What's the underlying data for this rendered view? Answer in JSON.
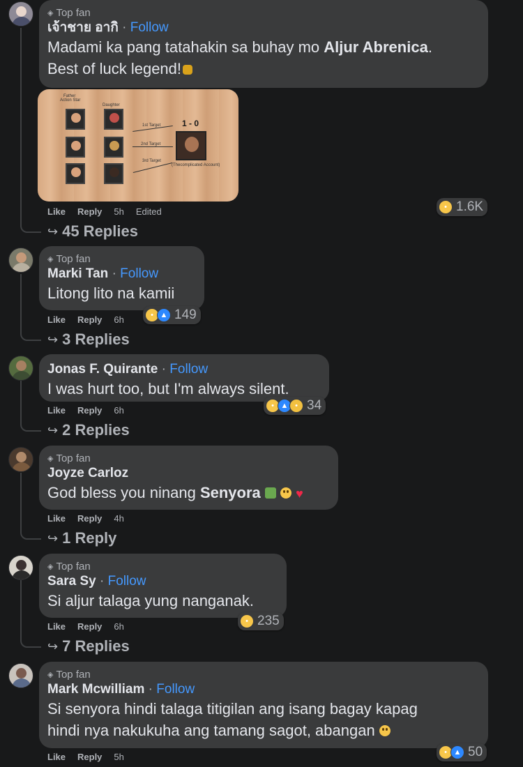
{
  "colors": {
    "background": "#18191a",
    "bubble": "#3a3b3c",
    "follow": "#4599ff",
    "muted": "#b0b3b8",
    "text": "#e4e6eb"
  },
  "comments": [
    {
      "badge": "Top fan",
      "author": "เจ้าชาย อากิ",
      "dot": "·",
      "follow": "Follow",
      "text_line1_pre": "Madami ka pang tatahakin sa buhay mo ",
      "text_line1_bold": "Aljur Abrenica",
      "text_line1_post": ".",
      "text_line2": "Best of luck legend!",
      "emoji_icon": "flexed-arm-icon",
      "media": {
        "labels": {
          "left_top": "Father",
          "left_sub": "Action Star",
          "mid_top": "Daughter",
          "target1": "1st Target",
          "target2": "2nd Target",
          "target3": "3rd Target",
          "score": "1 - 0",
          "caption": "(Thecomplicated Account)"
        }
      },
      "actions": {
        "like": "Like",
        "reply": "Reply",
        "time": "5h",
        "edited": "Edited"
      },
      "reactions": {
        "icons": [
          "haha"
        ],
        "count": "1.6K"
      },
      "replies": "45 Replies"
    },
    {
      "badge": "Top fan",
      "author": "Marki Tan",
      "dot": "·",
      "follow": "Follow",
      "text": "Litong lito na kamii",
      "actions": {
        "like": "Like",
        "reply": "Reply",
        "time": "6h"
      },
      "reactions": {
        "icons": [
          "haha",
          "like"
        ],
        "count": "149"
      },
      "replies": "3 Replies"
    },
    {
      "author": "Jonas F. Quirante",
      "dot": "·",
      "follow": "Follow",
      "text": "I was hurt too, but I'm always silent.",
      "actions": {
        "like": "Like",
        "reply": "Reply",
        "time": "6h"
      },
      "reactions": {
        "icons": [
          "haha",
          "like",
          "sad"
        ],
        "count": "34"
      },
      "replies": "2 Replies"
    },
    {
      "badge": "Top fan",
      "author": "Joyze Carloz",
      "text_pre": "God bless you ninang ",
      "text_bold": "Senyora",
      "emoji_icons": [
        "bouquet-icon",
        "relieved-face-icon",
        "red-heart-icon"
      ],
      "actions": {
        "like": "Like",
        "reply": "Reply",
        "time": "4h"
      },
      "replies": "1 Reply"
    },
    {
      "badge": "Top fan",
      "author": "Sara Sy",
      "dot": "·",
      "follow": "Follow",
      "text": "Si aljur talaga yung nanganak.",
      "actions": {
        "like": "Like",
        "reply": "Reply",
        "time": "6h"
      },
      "reactions": {
        "icons": [
          "haha"
        ],
        "count": "235"
      },
      "replies": "7 Replies"
    },
    {
      "badge": "Top fan",
      "author": "Mark Mcwilliam",
      "dot": "·",
      "follow": "Follow",
      "text_line1": "Si senyora hindi talaga titigilan ang isang bagay kapag",
      "text_line2": "hindi nya nakukuha ang tamang sagot, abangan",
      "emoji_icon": "astonished-face-icon",
      "actions": {
        "like": "Like",
        "reply": "Reply",
        "time": "5h"
      },
      "reactions": {
        "icons": [
          "haha",
          "like"
        ],
        "count": "50"
      }
    }
  ]
}
